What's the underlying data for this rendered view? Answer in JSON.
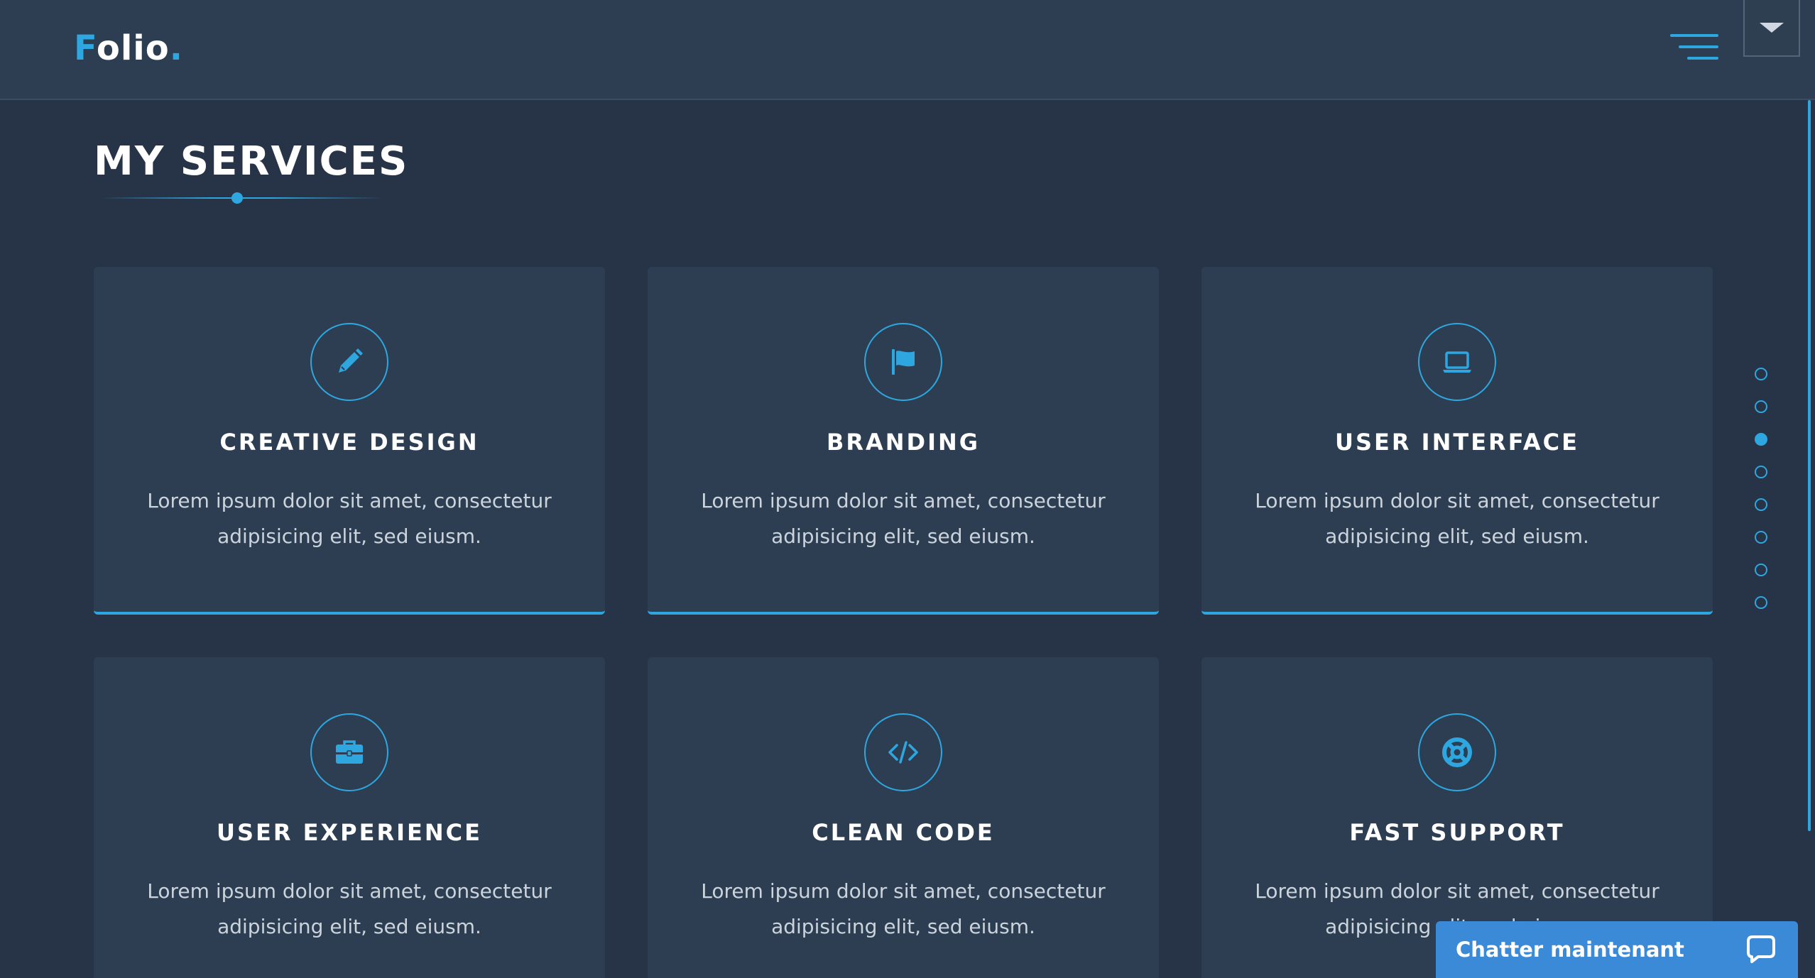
{
  "header": {
    "logo": {
      "first_letter": "F",
      "rest": "olio",
      "dot": "."
    }
  },
  "services": {
    "title": "MY SERVICES",
    "cards": [
      {
        "icon": "pencil-icon",
        "title": "CREATIVE DESIGN",
        "text": "Lorem ipsum dolor sit amet, consectetur adipisicing elit, sed eiusm."
      },
      {
        "icon": "flag-icon",
        "title": "BRANDING",
        "text": "Lorem ipsum dolor sit amet, consectetur adipisicing elit, sed eiusm."
      },
      {
        "icon": "laptop-icon",
        "title": "USER INTERFACE",
        "text": "Lorem ipsum dolor sit amet, consectetur adipisicing elit, sed eiusm."
      },
      {
        "icon": "briefcase-icon",
        "title": "USER EXPERIENCE",
        "text": "Lorem ipsum dolor sit amet, consectetur adipisicing elit, sed eiusm."
      },
      {
        "icon": "code-icon",
        "title": "CLEAN CODE",
        "text": "Lorem ipsum dolor sit amet, consectetur adipisicing elit, sed eiusm."
      },
      {
        "icon": "life-ring-icon",
        "title": "FAST SUPPORT",
        "text": "Lorem ipsum dolor sit amet, consectetur adipisicing elit, sed eiusm."
      }
    ]
  },
  "dot_nav": {
    "count": 8,
    "active_index": 2
  },
  "chat": {
    "label": "Chatter maintenant",
    "icon": "chat-bubble-icon"
  },
  "colors": {
    "accent": "#2ea7e0",
    "background": "#273447",
    "card": "#2d3e52",
    "chat": "#3b8ad8"
  }
}
